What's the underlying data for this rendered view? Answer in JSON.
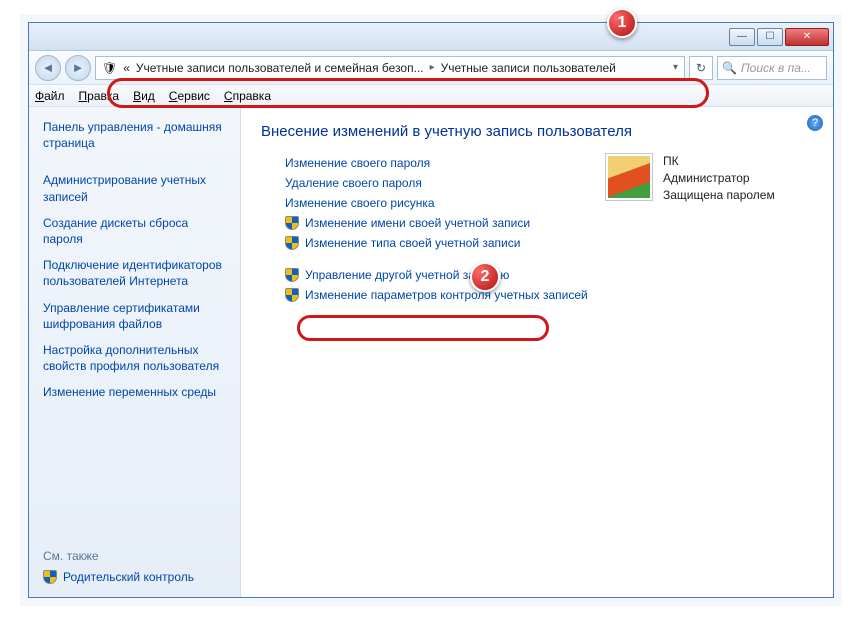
{
  "titlebar": {
    "min": "—",
    "max": "☐",
    "close": "✕"
  },
  "nav": {
    "back": "◄",
    "fwd": "►",
    "breadcrumb_prefix": "«",
    "breadcrumb1": "Учетные записи пользователей и семейная безоп...",
    "breadcrumb2": "Учетные записи пользователей",
    "arrow": "▸",
    "dropdown": "▾",
    "refresh": "↻",
    "search_placeholder": "Поиск в па...",
    "search_icon": "🔍"
  },
  "menu": {
    "file": "Файл",
    "edit": "Правка",
    "view": "Вид",
    "tools": "Сервис",
    "help": "Справка"
  },
  "sidebar": {
    "items": [
      "Панель управления - домашняя страница",
      "Администрирование учетных записей",
      "Создание дискеты сброса пароля",
      "Подключение идентификаторов пользователей Интернета",
      "Управление сертификатами шифрования файлов",
      "Настройка дополнительных свойств профиля пользователя",
      "Изменение переменных среды"
    ],
    "seealso_label": "См. также",
    "seealso_link": "Родительский контроль"
  },
  "main": {
    "heading": "Внесение изменений в учетную запись пользователя",
    "links1": [
      "Изменение своего пароля",
      "Удаление своего пароля",
      "Изменение своего рисунка"
    ],
    "links1_shield": [
      "Изменение имени своей учетной записи",
      "Изменение типа своей учетной записи"
    ],
    "links2_shield": [
      "Управление другой учетной записью",
      "Изменение параметров контроля учетных записей"
    ],
    "help": "?"
  },
  "user": {
    "name": "ПК",
    "role": "Администратор",
    "status": "Защищена паролем"
  },
  "badges": {
    "one": "1",
    "two": "2"
  }
}
